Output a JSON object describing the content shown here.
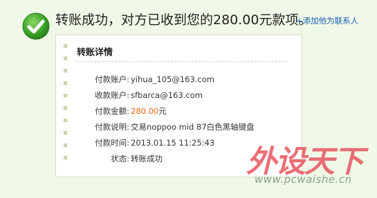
{
  "header": {
    "message": "转账成功，对方已收到您的280.00元款项。",
    "add_contact_link": "+添加他为联系人"
  },
  "details": {
    "title": "转账详情",
    "rows": [
      {
        "label": "付款账户:",
        "value": "yihua_105@163.com"
      },
      {
        "label": "收款账户:",
        "value": "sfbarca@163.com"
      },
      {
        "label": "付款金额:",
        "amount": "280.00",
        "unit": "元"
      },
      {
        "label": "付款说明:",
        "value": "交易noppoo mid 87白色黑轴键盘"
      },
      {
        "label": "付款时间:",
        "value": "2013.01.15 11:25:43"
      },
      {
        "label": "状态:",
        "value": "转账成功"
      }
    ]
  },
  "watermark": {
    "brand": "外设天下",
    "url": "www.pcwaishe.cn"
  },
  "colors": {
    "background": "#f0f9e8",
    "success_green": "#3a9a2a",
    "amount": "#e8640c",
    "link": "#1a5fb4",
    "watermark": "#e8555f"
  },
  "icons": {
    "success": "check-circle-icon"
  }
}
